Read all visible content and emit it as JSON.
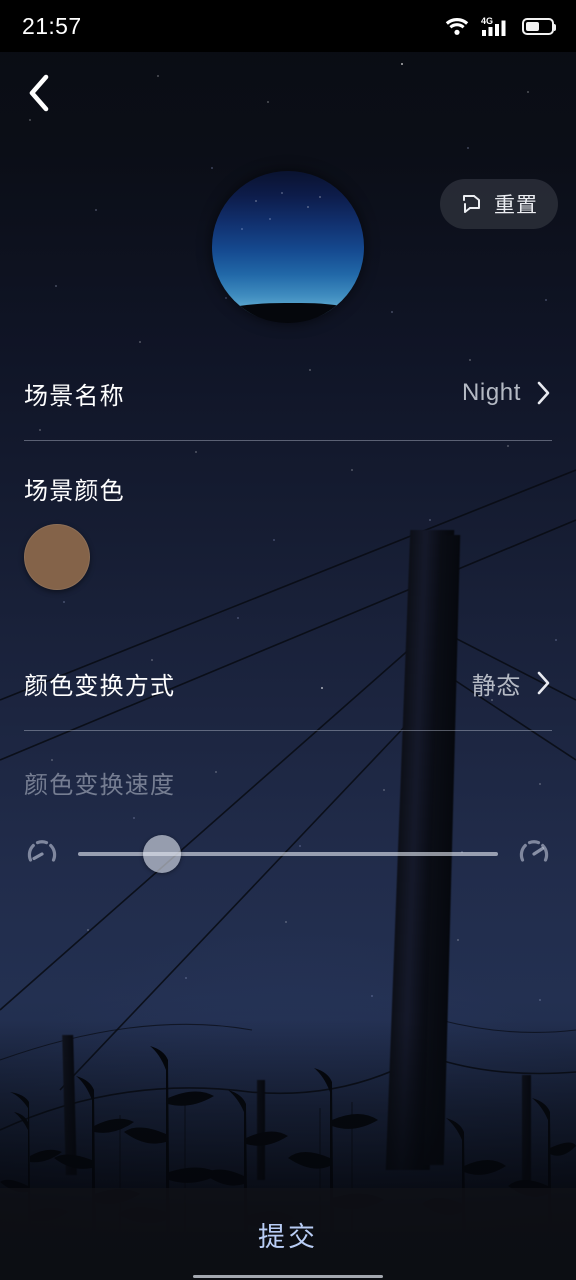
{
  "status_bar": {
    "time": "21:57",
    "icons": [
      "wifi-icon",
      "signal-4g-icon",
      "battery-icon"
    ],
    "network_label": "4G"
  },
  "top_bar": {
    "back_icon": "chevron-left-icon"
  },
  "reset_button": {
    "label": "重置",
    "icon": "reset-icon"
  },
  "preview": {
    "name": "scene-preview-circle"
  },
  "rows": {
    "scene_name": {
      "label": "场景名称",
      "value": "Night",
      "chevron": "chevron-right-icon"
    },
    "scene_color": {
      "label": "场景颜色",
      "swatch_color": "#846349"
    },
    "color_mode": {
      "label": "颜色变换方式",
      "value": "静态",
      "chevron": "chevron-right-icon"
    },
    "color_speed": {
      "label": "颜色变换速度",
      "disabled": true,
      "slow_icon": "speed-slow-icon",
      "fast_icon": "speed-fast-icon",
      "value_percent": 17
    }
  },
  "submit": {
    "label": "提交",
    "color": "#b9cdf5"
  }
}
